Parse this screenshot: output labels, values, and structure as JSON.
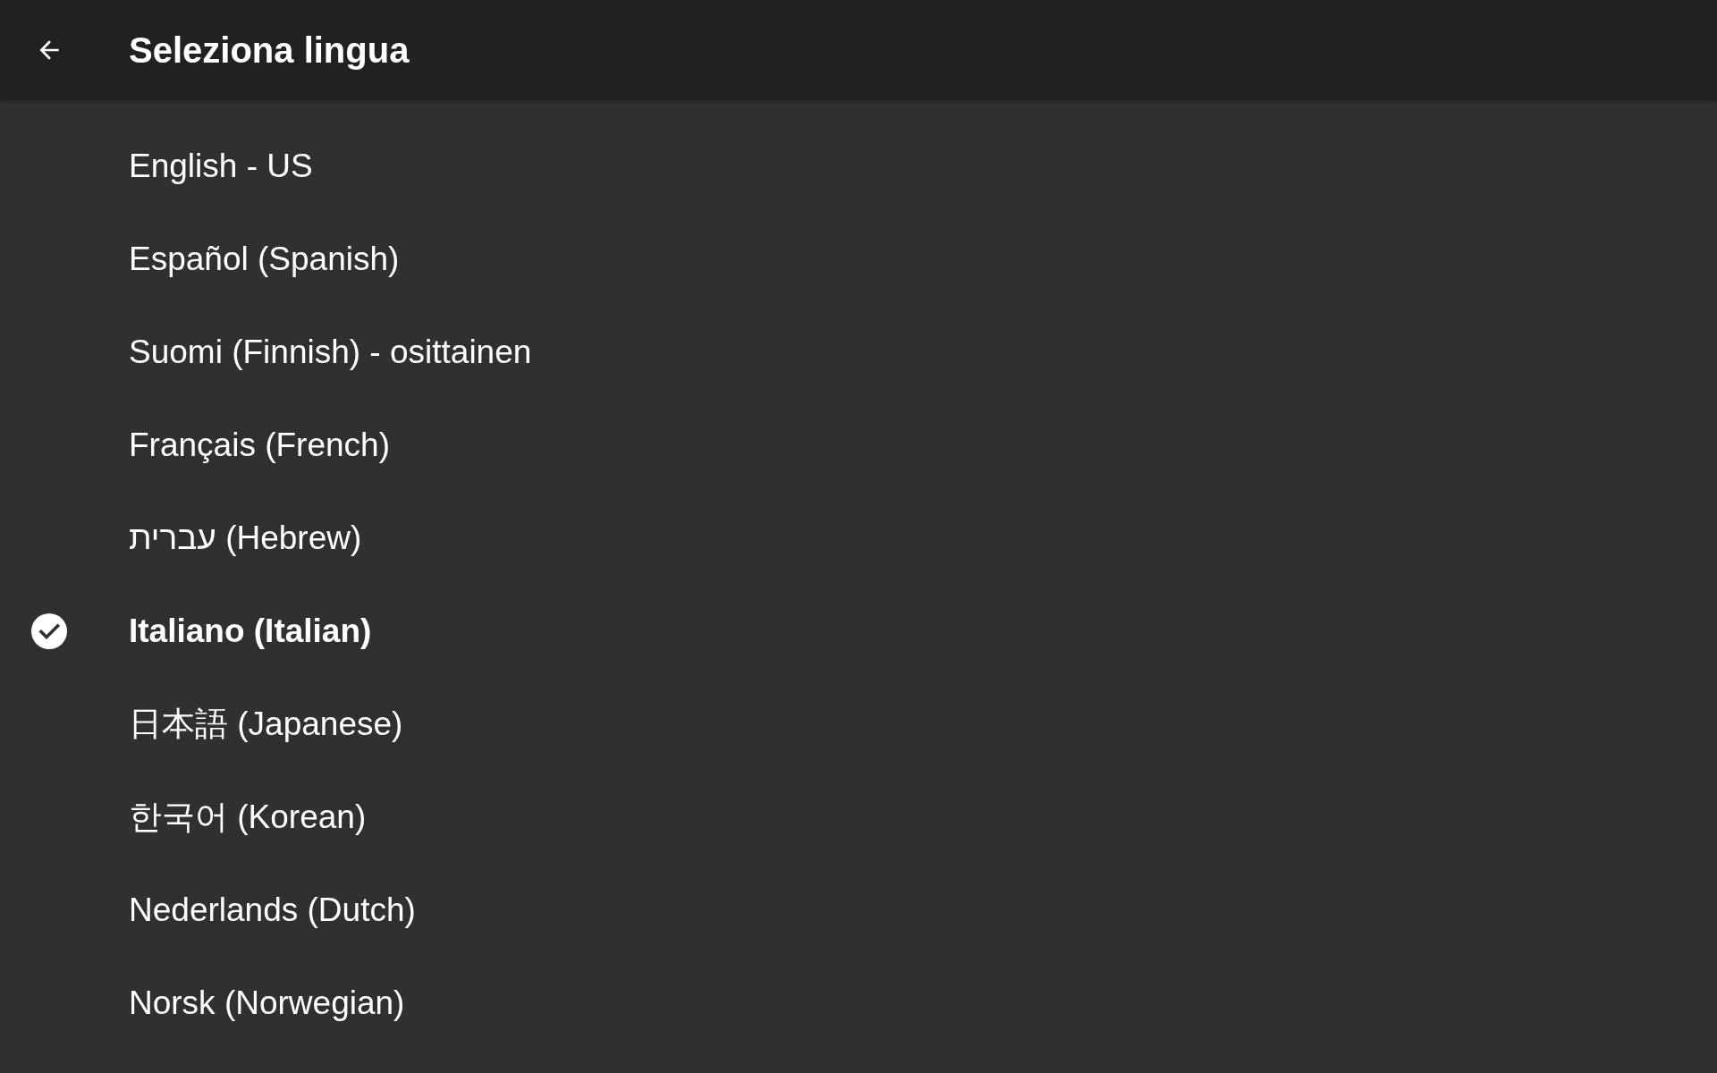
{
  "header": {
    "title": "Seleziona lingua"
  },
  "languages": [
    {
      "label": "English - US",
      "selected": false
    },
    {
      "label": "Español (Spanish)",
      "selected": false
    },
    {
      "label": "Suomi (Finnish) - osittainen",
      "selected": false
    },
    {
      "label": "Français (French)",
      "selected": false
    },
    {
      "label": "עברית (Hebrew)",
      "selected": false
    },
    {
      "label": "Italiano (Italian)",
      "selected": true
    },
    {
      "label": "日本語 (Japanese)",
      "selected": false
    },
    {
      "label": "한국어 (Korean)",
      "selected": false
    },
    {
      "label": "Nederlands (Dutch)",
      "selected": false
    },
    {
      "label": "Norsk (Norwegian)",
      "selected": false
    }
  ]
}
